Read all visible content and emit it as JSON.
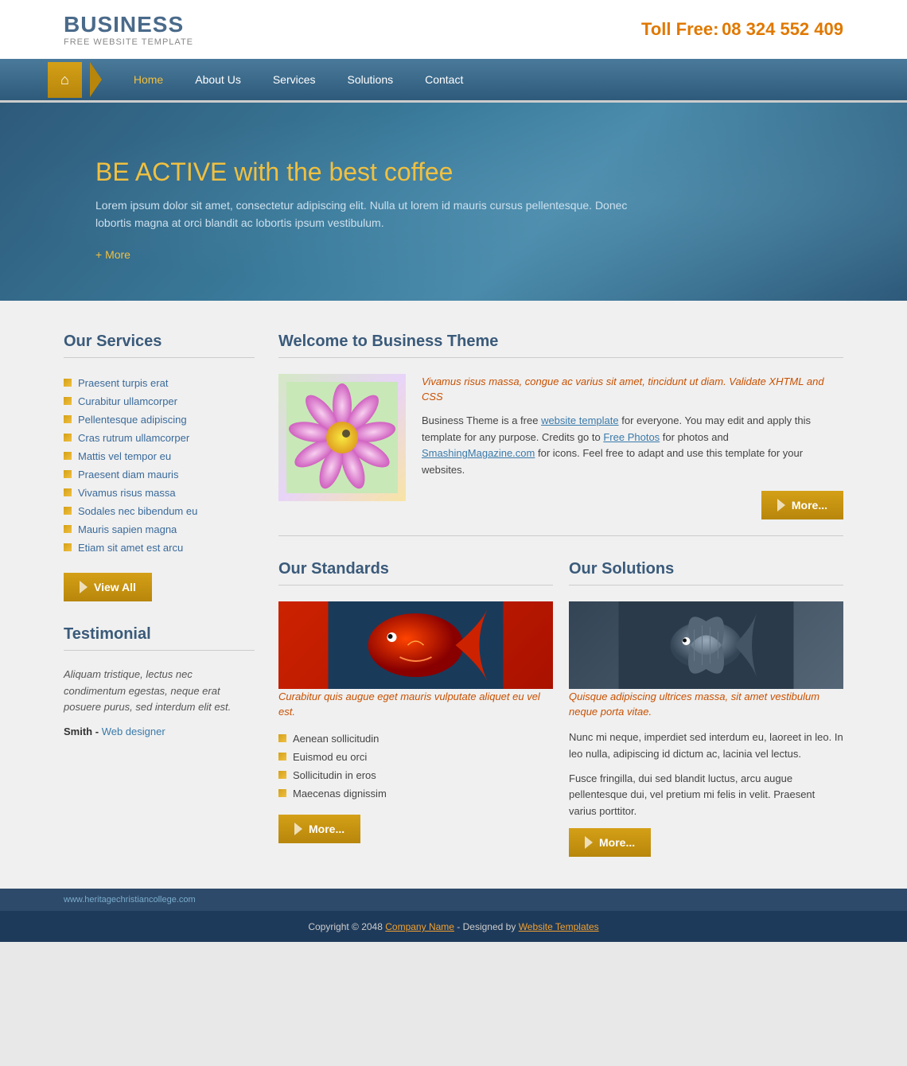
{
  "header": {
    "brand": "BUSINESS",
    "sub": "FREE WEBSITE TEMPLATE",
    "toll_label": "Toll Free:",
    "phone": "08 324 552 409"
  },
  "nav": {
    "home": "Home",
    "about": "About Us",
    "services": "Services",
    "solutions": "Solutions",
    "contact": "Contact"
  },
  "hero": {
    "title_main": "BE ACTIVE",
    "title_sub": " with the best coffee",
    "description": "Lorem ipsum dolor sit amet, consectetur adipiscing elit. Nulla ut lorem id mauris cursus pellentesque. Donec lobortis magna at orci blandit ac lobortis ipsum vestibulum.",
    "more_link": "+ More"
  },
  "sidebar": {
    "services_title": "Our Services",
    "services_list": [
      "Praesent turpis erat",
      "Curabitur ullamcorper",
      "Pellentesque adipiscing",
      "Cras rutrum ullamcorper",
      "Mattis vel tempor eu",
      "Praesent diam mauris",
      "Vivamus risus massa",
      "Sodales nec bibendum eu",
      "Mauris sapien magna",
      "Etiam sit amet est arcu"
    ],
    "view_all": "View All",
    "testimonial_title": "Testimonial",
    "testimonial_text": "Aliquam tristique, lectus nec condimentum egestas, neque erat posuere purus, sed interdum elit est.",
    "testimonial_author": "Smith",
    "testimonial_role": "Web designer"
  },
  "welcome": {
    "title": "Welcome to Business Theme",
    "italic_line": "Vivamus risus massa, congue ac varius sit amet, tincidunt ut diam. Validate XHTML and CSS",
    "body": "Business Theme is a free website template for everyone. You may edit and apply this template for any purpose. Credits go to Free Photos for photos and SmashingMagazine.com for icons. Feel free to adapt and use this template for your websites.",
    "more_btn": "More..."
  },
  "standards": {
    "title": "Our Standards",
    "caption": "Curabitur quis augue eget mauris vulputate aliquet eu vel est.",
    "list": [
      "Aenean sollicitudin",
      "Euismod eu orci",
      "Sollicitudin in eros",
      "Maecenas dignissim"
    ],
    "more_btn": "More..."
  },
  "solutions": {
    "title": "Our Solutions",
    "caption": "Quisque adipiscing ultrices massa, sit amet vestibulum neque porta vitae.",
    "body1": "Nunc mi neque, imperdiet sed interdum eu, laoreet in leo. In leo nulla, adipiscing id dictum ac, lacinia vel lectus.",
    "body2": "Fusce fringilla, dui sed blandit luctus, arcu augue pellentesque dui, vel pretium mi felis in velit. Praesent varius porttitor.",
    "more_btn": "More..."
  },
  "footer": {
    "url": "www.heritagechristiancollege.com",
    "copyright": "Copyright © 2048",
    "company_link": "Company Name",
    "designed_by": "- Designed by",
    "templates_link": "Website Templates"
  }
}
